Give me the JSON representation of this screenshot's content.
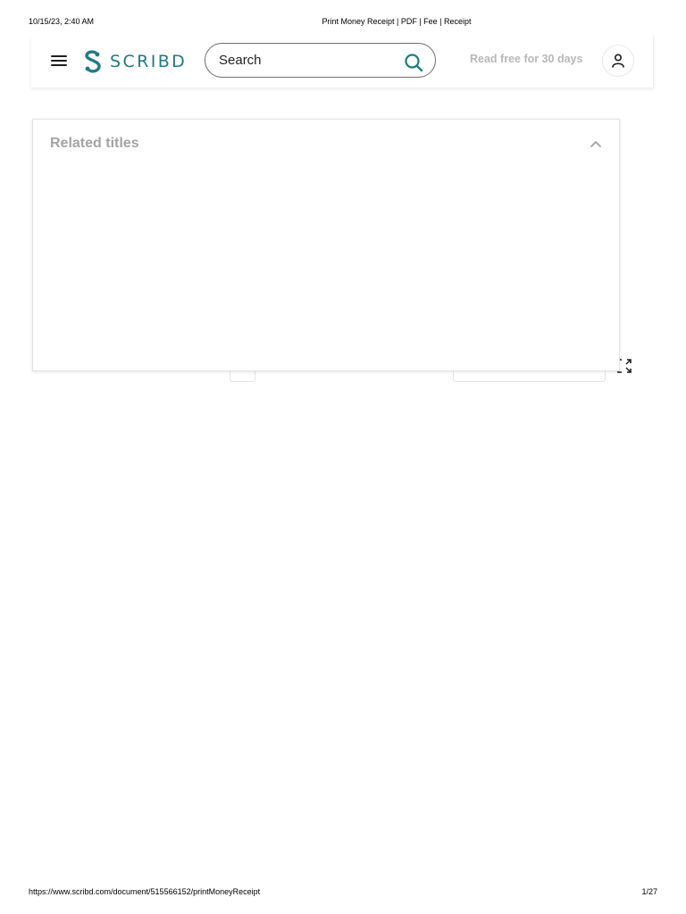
{
  "print_header": {
    "date": "10/15/23, 2:40 AM",
    "title": "Print Money Receipt | PDF | Fee | Receipt"
  },
  "print_footer": {
    "url": "https://www.scribd.com/document/515566152/printMoneyReceipt",
    "page": "1/27"
  },
  "site_header": {
    "logo_text": "SCRIBD",
    "search": {
      "placeholder": "Search",
      "value": ""
    },
    "read_free_label": "Read free for 30 days",
    "icons": {
      "menu": "hamburger-menu-icon",
      "logo": "scribd-logo-icon",
      "search": "search-icon",
      "account": "user-icon"
    }
  },
  "related_panel": {
    "title": "Related titles",
    "collapse_icon": "chevron-up-icon"
  },
  "viewer": {
    "fullscreen_icon": "fullscreen-icon"
  },
  "colors": {
    "brand": "#1e7b85",
    "muted_text": "#a4a4a4",
    "read_free_text": "#b8b8b8"
  }
}
